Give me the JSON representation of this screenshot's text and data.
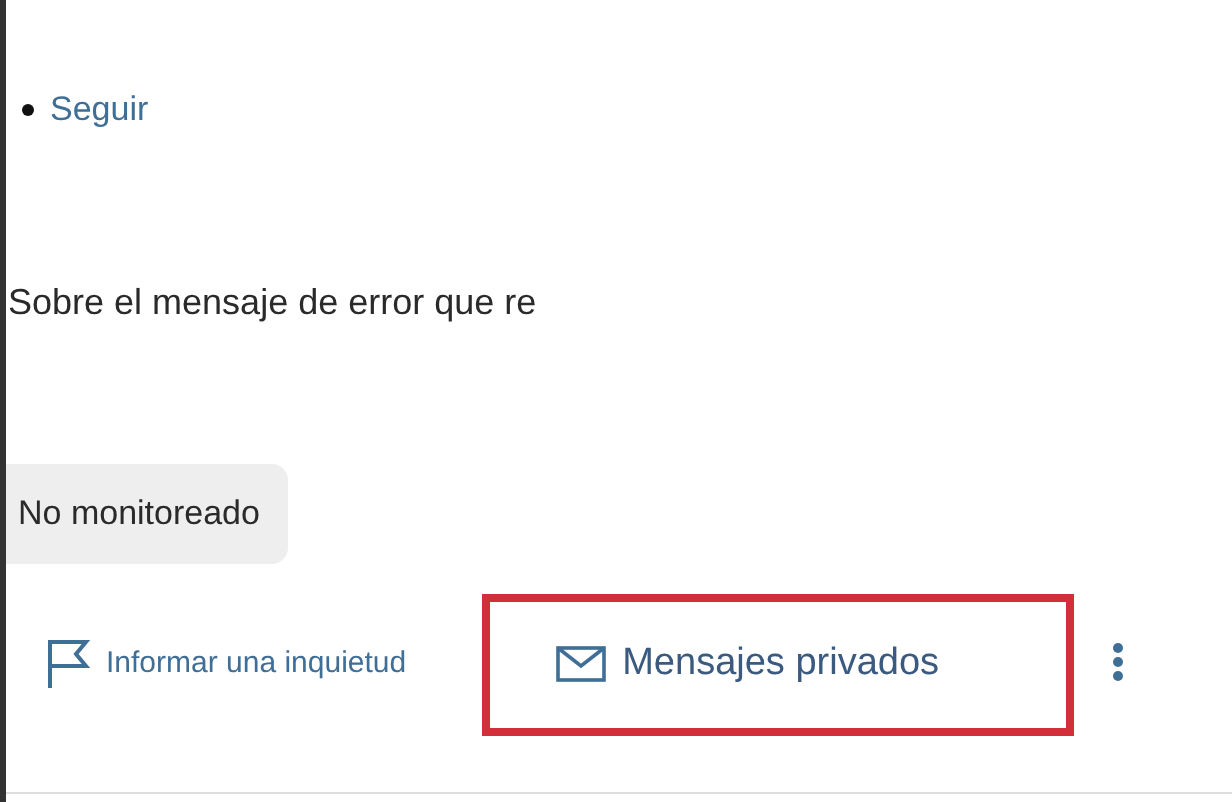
{
  "follow_link": {
    "label": "Seguir"
  },
  "message": "Sobre el mensaje de error que re",
  "status_badge": {
    "label": "No monitoreado"
  },
  "actions": [
    {
      "kind": "flag",
      "label": "Informar una inquietud",
      "highlighted": false
    },
    {
      "kind": "mail",
      "label": "Mensajes privados",
      "highlighted": true
    }
  ]
}
